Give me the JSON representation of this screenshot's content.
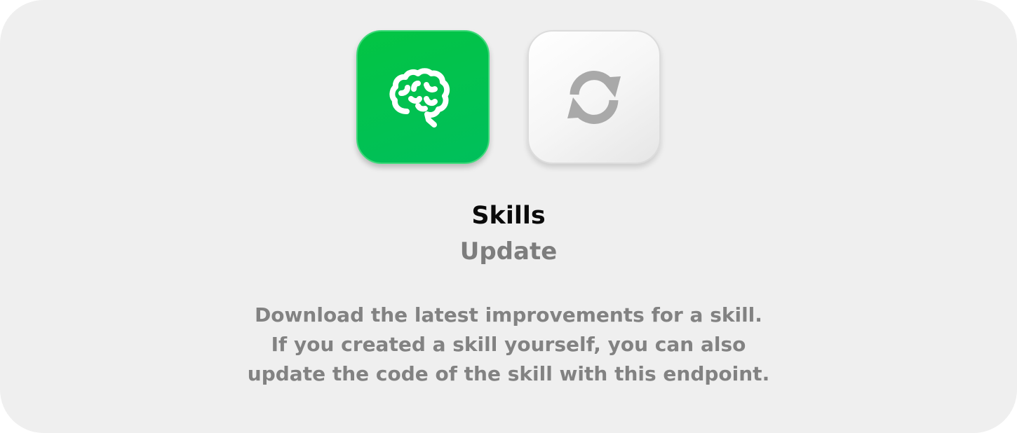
{
  "card": {
    "title": "Skills",
    "subtitle": "Update",
    "description_lines": [
      "Download the latest improvements for a skill.",
      "If you created a skill yourself, you can also",
      "update the code of the skill with this endpoint."
    ]
  },
  "icons": [
    {
      "name": "brain-icon",
      "tile": "skills",
      "color": "#ffffff",
      "background": "#00c04f"
    },
    {
      "name": "refresh-icon",
      "tile": "update",
      "color": "#a9a9a9",
      "background": "#f4f4f4"
    }
  ],
  "colors": {
    "card_background": "#efefef",
    "accent_green": "#00c04f",
    "title_text": "#0a0a0a",
    "muted_text": "#7d7d7d"
  }
}
